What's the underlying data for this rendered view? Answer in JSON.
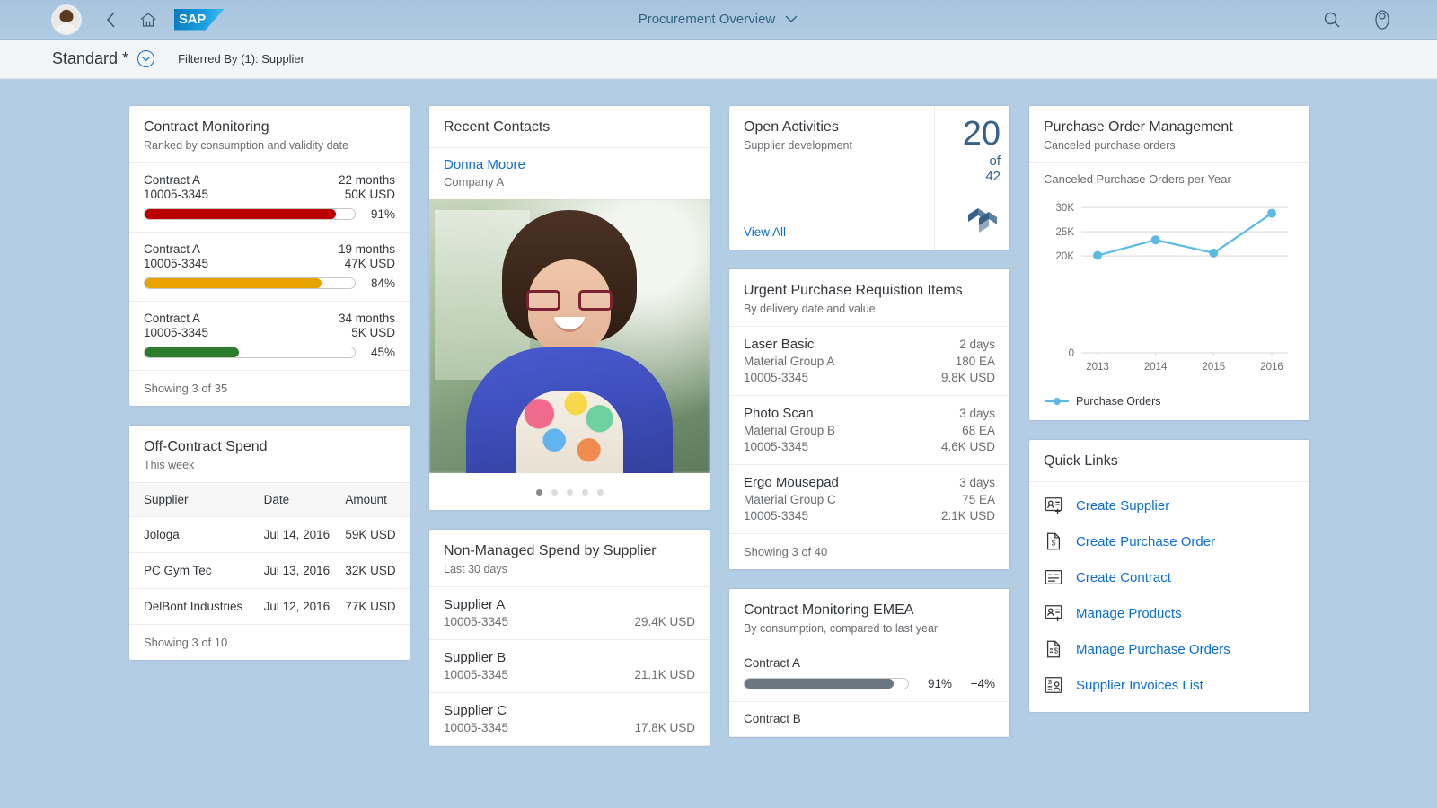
{
  "header": {
    "title": "Procurement Overview",
    "chevron": "⌄",
    "back_icon": "back-icon",
    "home_icon": "home-icon",
    "logo_text": "SAP",
    "search_icon": "search-icon",
    "user_settings_icon": "user-settings-icon"
  },
  "subbar": {
    "variant": "Standard *",
    "filtered_by": "Filterred By (1): Supplier"
  },
  "contract_monitoring": {
    "title": "Contract Monitoring",
    "subtitle": "Ranked by consumption and validity date",
    "rows": [
      {
        "name": "Contract A",
        "id": "10005-3345",
        "months": "22 months",
        "value": "50K USD",
        "pct_label": "91%",
        "pct": 91,
        "color": "#bb0000"
      },
      {
        "name": "Contract A",
        "id": "10005-3345",
        "months": "19 months",
        "value": "47K USD",
        "pct_label": "84%",
        "pct": 84,
        "color": "#e9a301"
      },
      {
        "name": "Contract A",
        "id": "10005-3345",
        "months": "34 months",
        "value": "5K USD",
        "pct_label": "45%",
        "pct": 45,
        "color": "#2b7d2b"
      }
    ],
    "footer": "Showing 3 of 35"
  },
  "off_contract_spend": {
    "title": "Off-Contract Spend",
    "subtitle": "This week",
    "columns": [
      "Supplier",
      "Date",
      "Amount"
    ],
    "rows": [
      [
        "Jologa",
        "Jul 14, 2016",
        "59K USD"
      ],
      [
        "PC Gym Tec",
        "Jul 13, 2016",
        "32K USD"
      ],
      [
        "DelBont Industries",
        "Jul 12, 2016",
        "77K USD"
      ]
    ],
    "footer": "Showing 3 of 10"
  },
  "recent_contacts": {
    "title": "Recent Contacts",
    "contact_name": "Donna Moore",
    "contact_company": "Company A",
    "carousel_dots": 5,
    "carousel_active": 0
  },
  "non_managed_spend": {
    "title": "Non-Managed Spend by Supplier",
    "subtitle": "Last 30 days",
    "rows": [
      {
        "name": "Supplier A",
        "id": "10005-3345",
        "amount": "29.4K USD"
      },
      {
        "name": "Supplier B",
        "id": "10005-3345",
        "amount": "21.1K USD"
      },
      {
        "name": "Supplier C",
        "id": "10005-3345",
        "amount": "17.8K USD"
      }
    ]
  },
  "open_activities": {
    "title": "Open Activities",
    "subtitle": "Supplier development",
    "view_all": "View All",
    "value": "20",
    "of_label": "of",
    "total": "42",
    "kpi_icon": "layers-icon",
    "accent": "#346187"
  },
  "urgent_pr": {
    "title": "Urgent Purchase Requistion Items",
    "subtitle": "By delivery date and value",
    "rows": [
      {
        "name": "Laser Basic",
        "days": "2 days",
        "group": "Material Group A",
        "qty": "180 EA",
        "id": "10005-3345",
        "value": "9.8K USD"
      },
      {
        "name": "Photo Scan",
        "days": "3 days",
        "group": "Material Group B",
        "qty": "68 EA",
        "id": "10005-3345",
        "value": "4.6K USD"
      },
      {
        "name": "Ergo Mousepad",
        "days": "3 days",
        "group": "Material Group C",
        "qty": "75 EA",
        "id": "10005-3345",
        "value": "2.1K USD"
      }
    ],
    "footer": "Showing 3 of 40"
  },
  "contract_emea": {
    "title": "Contract Monitoring EMEA",
    "subtitle": "By consumption, compared to last year",
    "rows": [
      {
        "name": "Contract A",
        "pct_label": "91%",
        "pct": 91,
        "delta": "+4%",
        "color": "#6a7680"
      },
      {
        "name": "Contract B",
        "pct_label": "",
        "pct": 0,
        "delta": "",
        "color": "#6a7680"
      }
    ]
  },
  "purchase_order_mgmt": {
    "title": "Purchase Order Management",
    "subtitle": "Canceled purchase orders"
  },
  "chart_data": {
    "type": "line",
    "title": "Canceled Purchase Orders per Year",
    "xlabel": "",
    "ylabel": "",
    "categories": [
      "2013",
      "2014",
      "2015",
      "2016"
    ],
    "x": [
      2013,
      2014,
      2015,
      2016
    ],
    "series": [
      {
        "name": "Purchase Orders",
        "values": [
          20100,
          23300,
          20600,
          28800
        ],
        "color": "#5cbae5"
      }
    ],
    "ytick_labels": [
      "30K",
      "25K",
      "20K",
      "0"
    ],
    "ytick_values": [
      30000,
      25000,
      20000,
      0
    ],
    "ylim": [
      0,
      31500
    ],
    "grid": true,
    "legend": [
      "Purchase Orders"
    ],
    "legend_position": "bottom-left"
  },
  "quick_links": {
    "title": "Quick Links",
    "items": [
      {
        "label": "Create Supplier",
        "icon": "add-contact-icon"
      },
      {
        "label": "Create Purchase Order",
        "icon": "document-dollar-icon"
      },
      {
        "label": "Create Contract",
        "icon": "contract-card-icon"
      },
      {
        "label": "Manage Products",
        "icon": "add-contact-icon"
      },
      {
        "label": "Manage Purchase Orders",
        "icon": "document-list-dollar-icon"
      },
      {
        "label": "Supplier Invoices List",
        "icon": "invoice-person-icon"
      }
    ]
  }
}
